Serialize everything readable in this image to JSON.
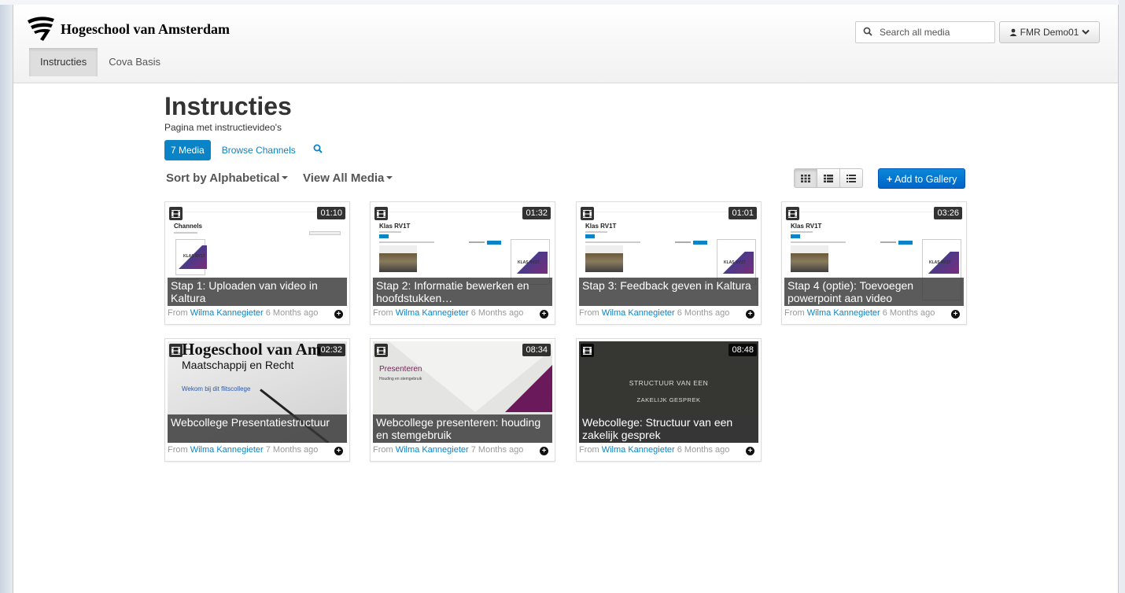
{
  "header": {
    "logo_text": "Hogeschool van Amsterdam",
    "nav": [
      {
        "label": "Instructies",
        "active": true
      },
      {
        "label": "Cova Basis",
        "active": false
      }
    ],
    "search_placeholder": "Search all media",
    "user_label": "FMR Demo01"
  },
  "page": {
    "title": "Instructies",
    "subtitle": "Pagina met instructievideo's",
    "tabs": [
      {
        "label": "7 Media",
        "active": true
      },
      {
        "label": "Browse Channels",
        "active": false
      }
    ],
    "sort_label": "Sort by Alphabetical",
    "view_label": "View All Media",
    "add_button": "Add to Gallery",
    "accent": "#0a84c6"
  },
  "media": [
    {
      "title": "Stap 1: Uploaden van video in Kaltura",
      "duration": "01:10",
      "from": "From",
      "author": "Wilma Kannegieter",
      "age": "6 Months ago",
      "thumb": "channels",
      "thumb_text": "Channels"
    },
    {
      "title": "Stap 2: Informatie bewerken en hoofdstukken…",
      "duration": "01:32",
      "from": "From",
      "author": "Wilma Kannegieter",
      "age": "6 Months ago",
      "thumb": "klas",
      "thumb_text": "Klas RV1T"
    },
    {
      "title": "Stap 3: Feedback geven in Kaltura",
      "duration": "01:01",
      "from": "From",
      "author": "Wilma Kannegieter",
      "age": "6 Months ago",
      "thumb": "klas",
      "thumb_text": "Klas RV1T"
    },
    {
      "title": "Stap 4 (optie): Toevoegen powerpoint aan video",
      "duration": "03:26",
      "from": "From",
      "author": "Wilma Kannegieter",
      "age": "6 Months ago",
      "thumb": "klas",
      "thumb_text": "Klas RV1T"
    },
    {
      "title": "Webcollege Presentatiestructuur",
      "duration": "02:32",
      "from": "From",
      "author": "Wilma Kannegieter",
      "age": "7 Months ago",
      "thumb": "hva",
      "thumb_text": "Hogeschool van Am",
      "thumb_sub": "Maatschappij en Recht",
      "thumb_small": "Wekom bij dit flitscollege"
    },
    {
      "title": "Webcollege presenteren: houding en stemgebruik",
      "duration": "08:34",
      "from": "From",
      "author": "Wilma Kannegieter",
      "age": "7 Months ago",
      "thumb": "pres",
      "thumb_text": "Presenteren",
      "thumb_sub": "Houding en stemgebruik"
    },
    {
      "title": "Webcollege: Structuur van een zakelijk gesprek",
      "duration": "08:48",
      "from": "From",
      "author": "Wilma Kannegieter",
      "age": "6 Months ago",
      "thumb": "dark",
      "thumb_text": "STRUCTUUR VAN EEN",
      "thumb_sub": "ZAKELIJK GESPREK"
    }
  ]
}
